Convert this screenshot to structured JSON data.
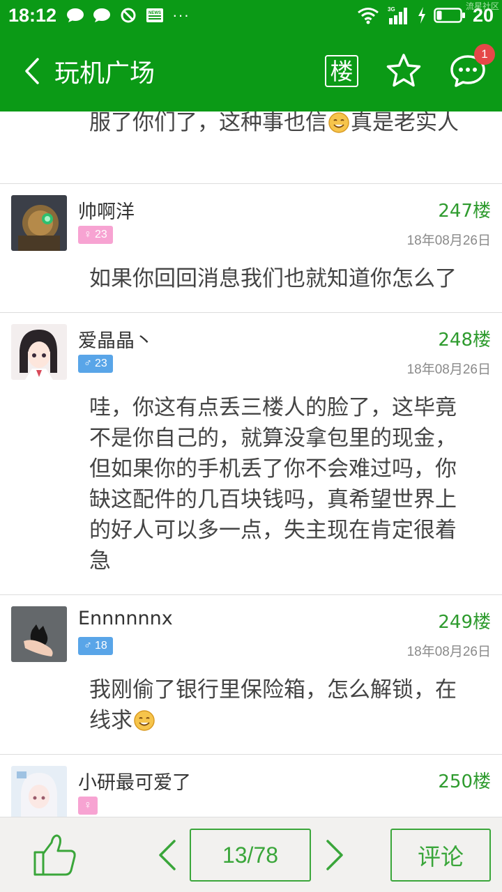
{
  "status_bar": {
    "time": "18:12",
    "battery": "20",
    "watermark": "流星社区",
    "network_label": "3G",
    "news_label": "NEWS",
    "more_dots": "···"
  },
  "app_bar": {
    "title": "玩机广场",
    "floor_button_label": "楼",
    "message_badge_count": "1"
  },
  "top_fragment": {
    "text_before_emoji": "服了你们了，这种事也信",
    "text_after_emoji": "真是老实人"
  },
  "posts": [
    {
      "username": "帅啊洋",
      "gender": "female",
      "gender_symbol": "♀",
      "level": "23",
      "floor": "247楼",
      "date": "18年08月26日",
      "content_before_emoji": "如果你回回消息我们也就知道你怎么了",
      "content_after_emoji": ""
    },
    {
      "username": "爱晶晶丶",
      "gender": "male",
      "gender_symbol": "♂",
      "level": "23",
      "floor": "248楼",
      "date": "18年08月26日",
      "content_before_emoji": "哇，你这有点丢三楼人的脸了，这毕竟不是你自己的，就算没拿包里的现金，但如果你的手机丢了你不会难过吗，你缺这配件的几百块钱吗，真希望世界上的好人可以多一点，失主现在肯定很着急",
      "content_after_emoji": ""
    },
    {
      "username": "Ennnnnnx",
      "gender": "male",
      "gender_symbol": "♂",
      "level": "18",
      "floor": "249楼",
      "date": "18年08月26日",
      "content_before_emoji": "我刚偷了银行里保险箱，怎么解锁，在线求",
      "content_after_emoji": ""
    },
    {
      "username": "小研最可爱了",
      "gender": "female",
      "gender_symbol": "♀",
      "level": "",
      "floor": "250楼",
      "date": "",
      "content_before_emoji": "",
      "content_after_emoji": ""
    }
  ],
  "bottom_bar": {
    "page_indicator": "13/78",
    "comment_label": "评论"
  },
  "colors": {
    "brand_green": "#0b9a16",
    "accent_green": "#3aa63a",
    "badge_red": "#e54848",
    "male_badge": "#59a5e8",
    "female_badge": "#f7a3d2"
  }
}
